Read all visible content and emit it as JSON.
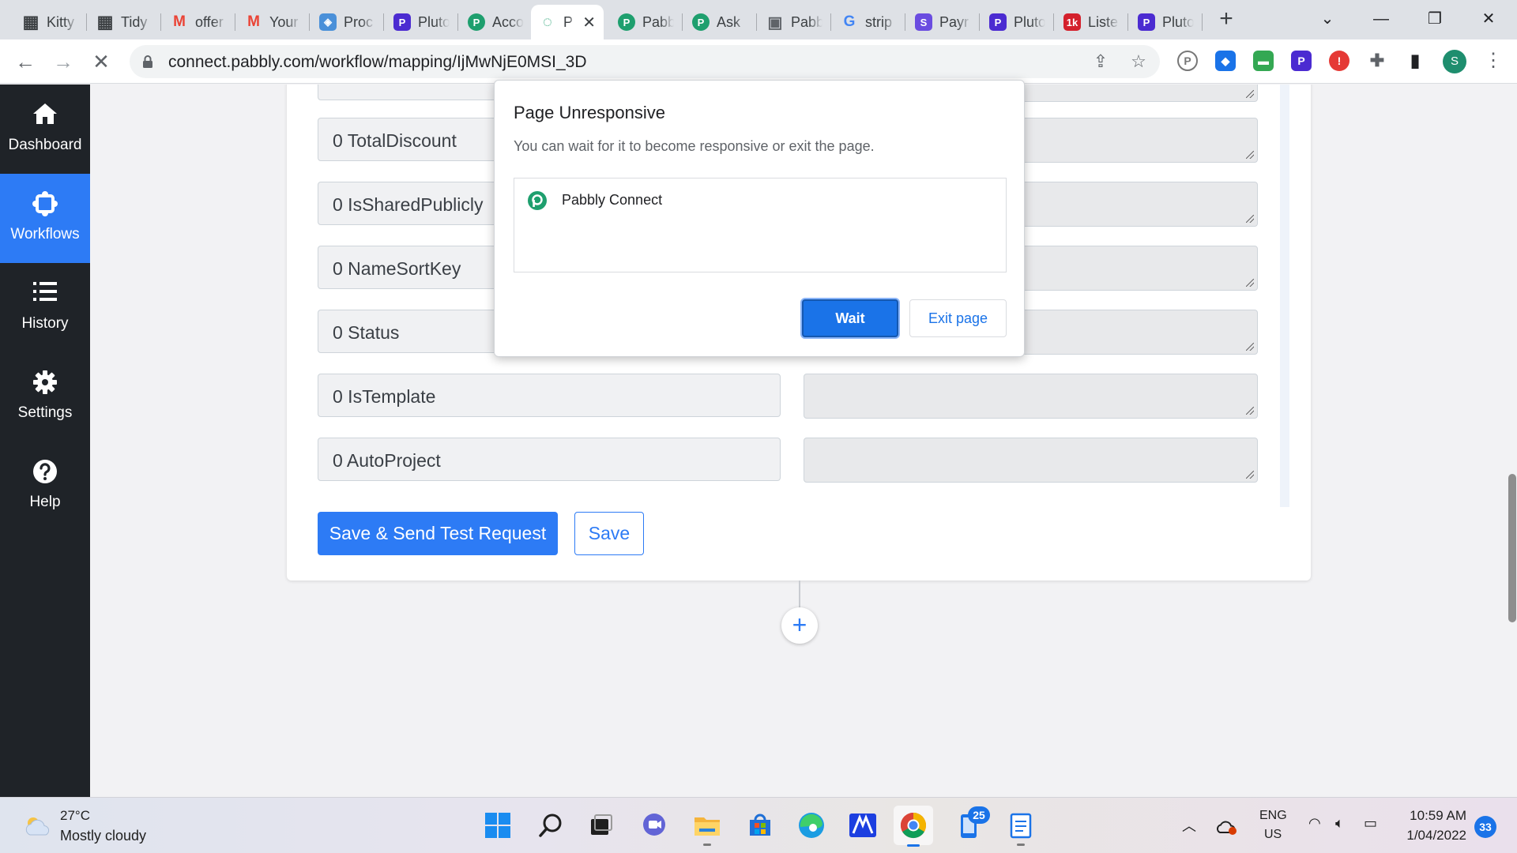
{
  "browser": {
    "tabs": [
      {
        "title": "Kitty",
        "icon": "calendar-icon",
        "color": "#3c4043"
      },
      {
        "title": "Tidy",
        "icon": "calendar-icon",
        "color": "#3c4043"
      },
      {
        "title": "offer",
        "icon": "gmail-icon",
        "color": "#ea4335"
      },
      {
        "title": "Your",
        "icon": "gmail-icon",
        "color": "#ea4335"
      },
      {
        "title": "Proc",
        "icon": "shield-icon",
        "color": "#4a90d9"
      },
      {
        "title": "Pluto",
        "icon": "pluto-icon",
        "color": "#4b2bd1"
      },
      {
        "title": "Acco",
        "icon": "pabbly-icon",
        "color": "#1e9f6e"
      },
      {
        "title": "P",
        "icon": "pabbly-loading-icon",
        "color": "#1e9f6e",
        "active": true
      },
      {
        "title": "Pabb",
        "icon": "pabbly-icon",
        "color": "#1e9f6e"
      },
      {
        "title": "Ask",
        "icon": "pabbly-icon",
        "color": "#1e9f6e"
      },
      {
        "title": "Pabb",
        "icon": "photo-icon",
        "color": "#5f6368"
      },
      {
        "title": "strip",
        "icon": "google-icon",
        "color": "#4285f4"
      },
      {
        "title": "Payr",
        "icon": "s-icon",
        "color": "#6a4ce0"
      },
      {
        "title": "Pluto",
        "icon": "pluto-icon",
        "color": "#4b2bd1"
      },
      {
        "title": "Liste",
        "icon": "1k-icon",
        "color": "#d4202c"
      },
      {
        "title": "Pluto",
        "icon": "pluto-icon",
        "color": "#4b2bd1"
      }
    ],
    "url": "connect.pabbly.com/workflow/mapping/IjMwNjE0MSI_3D",
    "profile_initial": "S"
  },
  "sidebar": {
    "items": [
      {
        "label": "Dashboard",
        "icon": "home-icon"
      },
      {
        "label": "Workflows",
        "icon": "workflows-icon",
        "active": true
      },
      {
        "label": "History",
        "icon": "list-icon"
      },
      {
        "label": "Settings",
        "icon": "gear-icon"
      },
      {
        "label": "Help",
        "icon": "help-icon"
      }
    ]
  },
  "mapping": {
    "fields": [
      "0 TotalDiscount",
      "0 IsSharedPublicly",
      "0 NameSortKey",
      "0 Status",
      "0 IsTemplate",
      "0 AutoProject"
    ],
    "save_send_label": "Save & Send Test Request",
    "save_label": "Save"
  },
  "dialog": {
    "title": "Page Unresponsive",
    "message": "You can wait for it to become responsive or exit the page.",
    "item": "Pabbly Connect",
    "wait_label": "Wait",
    "exit_label": "Exit page"
  },
  "taskbar": {
    "temperature": "27°C",
    "condition": "Mostly cloudy",
    "badge": "25",
    "lang_line1": "ENG",
    "lang_line2": "US",
    "time": "10:59 AM",
    "date": "1/04/2022",
    "notifications": "33"
  },
  "colors": {
    "accent": "#2d7bf5",
    "sidebar_bg": "#1f2328",
    "pabbly_green": "#1e9f6e"
  }
}
